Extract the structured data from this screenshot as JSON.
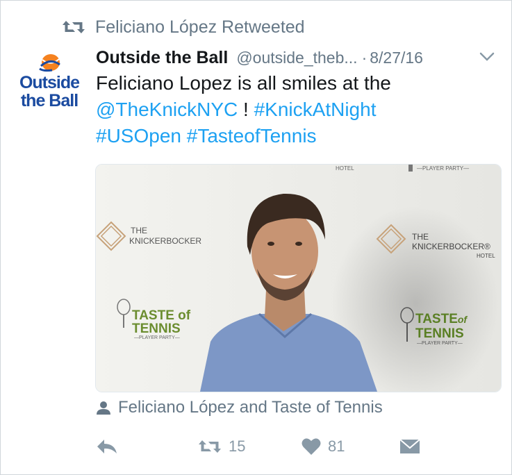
{
  "retweet_banner": {
    "text": "Feliciano López Retweeted",
    "icon": "retweet-icon"
  },
  "tweet": {
    "author_name": "Outside the Ball",
    "author_handle": "@outside_theb...",
    "separator": "·",
    "date": "8/27/16",
    "text_plain_1": "Feliciano Lopez is all smiles at the",
    "mention": "@TheKnickNYC",
    "text_plain_2": " ! ",
    "hashtag_1": "#KnickAtNight",
    "hashtag_2": "#USOpen",
    "hashtag_3": "#TasteofTennis"
  },
  "avatar": {
    "line1": "Outside",
    "line2": "the Ball"
  },
  "photo": {
    "backdrop": {
      "hotel": "HOTEL",
      "player_party": "—PLAYER PARTY—",
      "the": "THE",
      "knickerbocker": "KNICKERBOCKER",
      "knickerbocker_right": "KNICKERBOCKER®",
      "taste_of": "TASTE of",
      "taste": "TASTE",
      "of": "of",
      "tennis": "TENNIS",
      "player_party_small": "—PLAYER PARTY—"
    }
  },
  "tagged": {
    "text": "Feliciano López and Taste of Tennis",
    "icon": "person-icon"
  },
  "actions": {
    "retweet_count": "15",
    "like_count": "81"
  },
  "colors": {
    "link": "#1da1f2",
    "muted": "#657786",
    "brand_blue": "#1b4ba0",
    "brand_orange": "#f58220"
  }
}
